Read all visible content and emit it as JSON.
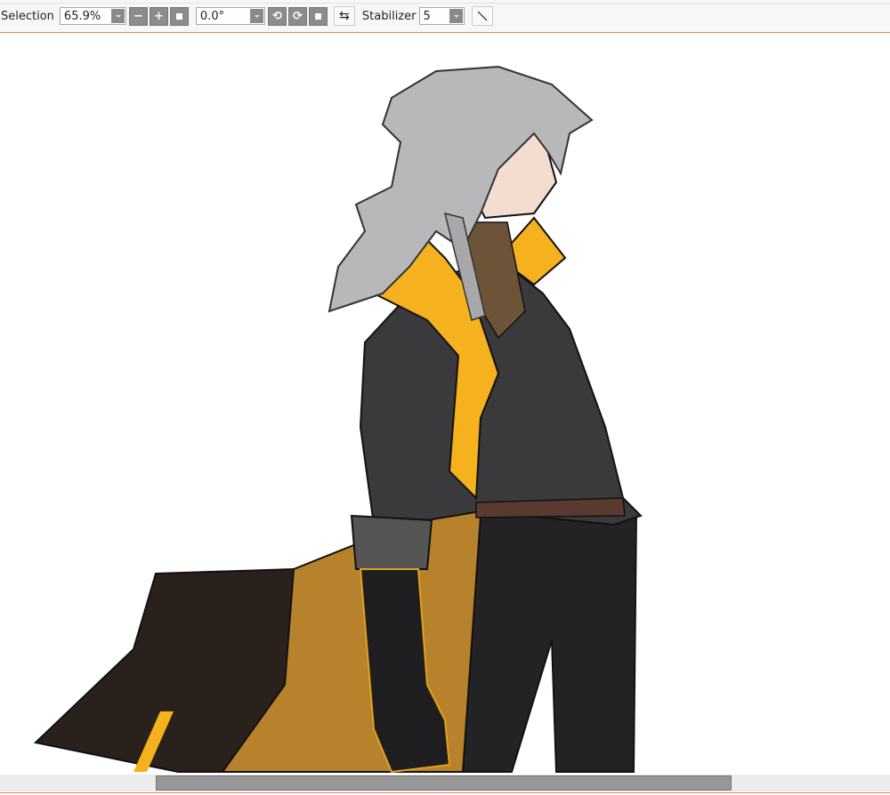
{
  "toolbar": {
    "selection_label": "Selection",
    "zoom_value": "65.9%",
    "zoom_out_icon": "minus-icon",
    "zoom_in_icon": "plus-icon",
    "zoom_reset_icon": "square-icon",
    "rotation_value": "0.0°",
    "rotate_ccw_icon": "rotate-ccw-icon",
    "rotate_cw_icon": "rotate-cw-icon",
    "rotate_reset_icon": "square-icon",
    "flip_icon": "flip-horizontal-icon",
    "stabilizer_label": "Stabilizer",
    "stabilizer_value": "5",
    "line_tool_icon": "diagonal-line-icon"
  },
  "colors": {
    "accent_line": "#e08a55",
    "hair": "#b8b8ba",
    "coat": "#3a3a3c",
    "gold": "#f5b21e",
    "cape_inner": "#b8822c",
    "cape_outer": "#2a211d"
  },
  "scrollbar": {
    "horizontal_position": 0.17,
    "visible_fraction": 0.65
  }
}
